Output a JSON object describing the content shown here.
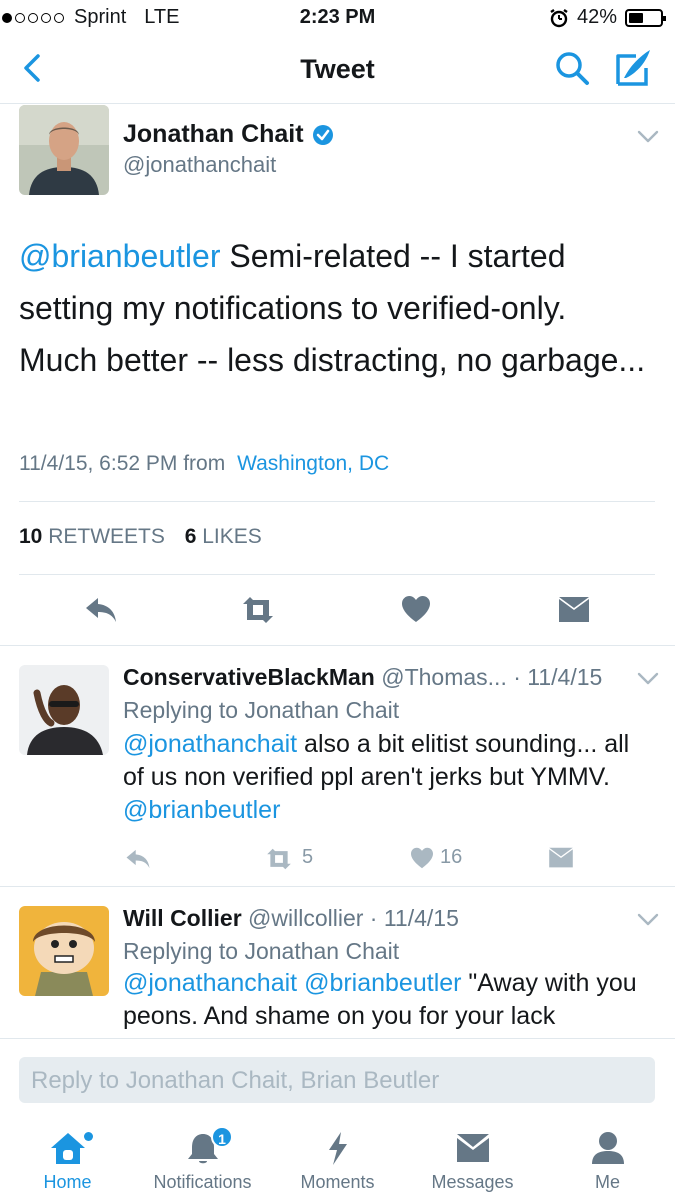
{
  "status_bar": {
    "carrier": "Sprint",
    "network": "LTE",
    "time": "2:23 PM",
    "battery": "42%",
    "battery_level": 0.42
  },
  "nav": {
    "title": "Tweet"
  },
  "tweet": {
    "author_name": "Jonathan Chait",
    "author_handle": "@jonathanchait",
    "mention": "@brianbeutler",
    "text": " Semi-related -- I started setting my notifications to verified-only. Much better -- less distracting, no garbage...",
    "timestamp": "11/4/15, 6:52 PM from",
    "location": "Washington, DC",
    "retweet_count": "10",
    "retweet_label": "RETWEETS",
    "like_count": "6",
    "like_label": "LIKES"
  },
  "replies": [
    {
      "name": "ConservativeBlackMan",
      "handle": "@Thomas...",
      "date": "· 11/4/15",
      "replying_to": "Replying to Jonathan Chait",
      "mention1": "@jonathanchait",
      "text": " also a bit elitist sounding... all of us non verified ppl aren't jerks but YMMV. ",
      "mention2": "@brianbeutler",
      "retweets": "5",
      "likes": "16"
    },
    {
      "name": "Will Collier",
      "handle": "@willcollier",
      "date": "· 11/4/15",
      "replying_to": "Replying to Jonathan Chait",
      "mention1": "@jonathanchait",
      "mention2": "@brianbeutler",
      "text": " \"Away with you peons. And shame on you for your lack"
    }
  ],
  "composer": {
    "placeholder": "Reply to Jonathan Chait, Brian Beutler"
  },
  "tabbar": {
    "items": [
      {
        "label": "Home"
      },
      {
        "label": "Notifications",
        "badge": "1"
      },
      {
        "label": "Moments"
      },
      {
        "label": "Messages"
      },
      {
        "label": "Me"
      }
    ]
  },
  "colors": {
    "accent": "#1b95e0",
    "text": "#14171a",
    "muted": "#657786",
    "divider": "#e1e8ed"
  }
}
